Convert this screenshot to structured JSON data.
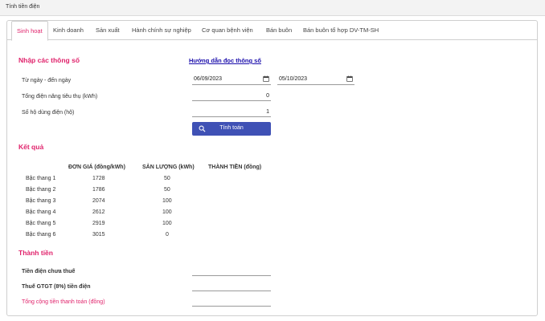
{
  "window": {
    "title": "Tính tiền điện"
  },
  "tabs": [
    {
      "label": "Sinh hoạt",
      "active": true
    },
    {
      "label": "Kinh doanh"
    },
    {
      "label": "Sản xuất"
    },
    {
      "label": "Hành chính sự nghiệp"
    },
    {
      "label": "Cơ quan bệnh viện"
    },
    {
      "label": "Bán buôn"
    },
    {
      "label": "Bán buôn tổ hợp DV-TM-SH"
    }
  ],
  "inputs_section": {
    "title": "Nhập các thông số",
    "guide_link": "Hướng dẫn đọc thông số",
    "date_range_label": "Từ ngày - đến ngày",
    "from_date": "06/09/2023",
    "to_date": "05/10/2023",
    "consumption_label": "Tổng điện năng tiêu thụ (kWh)",
    "consumption_value": "0",
    "households_label": "Số hộ dùng điện (hộ)",
    "households_value": "1",
    "calc_button": "Tính toán",
    "accent_color": "#e0226b",
    "button_color": "#3f51b5"
  },
  "results": {
    "title": "Kết quả",
    "columns": [
      "ĐƠN GIÁ (đồng/kWh)",
      "SẢN LƯỢNG (kWh)",
      "THÀNH TIỀN (đồng)"
    ],
    "rows": [
      {
        "tier": "Bậc thang 1",
        "price": "1728",
        "qty": "50",
        "amount": ""
      },
      {
        "tier": "Bậc thang 2",
        "price": "1786",
        "qty": "50",
        "amount": ""
      },
      {
        "tier": "Bậc thang 3",
        "price": "2074",
        "qty": "100",
        "amount": ""
      },
      {
        "tier": "Bậc thang 4",
        "price": "2612",
        "qty": "100",
        "amount": ""
      },
      {
        "tier": "Bậc thang 5",
        "price": "2919",
        "qty": "100",
        "amount": ""
      },
      {
        "tier": "Bậc thang 6",
        "price": "3015",
        "qty": "0",
        "amount": ""
      }
    ]
  },
  "totals": {
    "title": "Thành tiền",
    "pre_tax_label": "Tiền điện chưa thuế",
    "vat_label": "Thuế GTGT (8%) tiền điện",
    "grand_total_label": "Tổng cộng tiền thanh toán (đồng)",
    "pre_tax_value": "",
    "vat_value": "",
    "grand_total_value": ""
  }
}
